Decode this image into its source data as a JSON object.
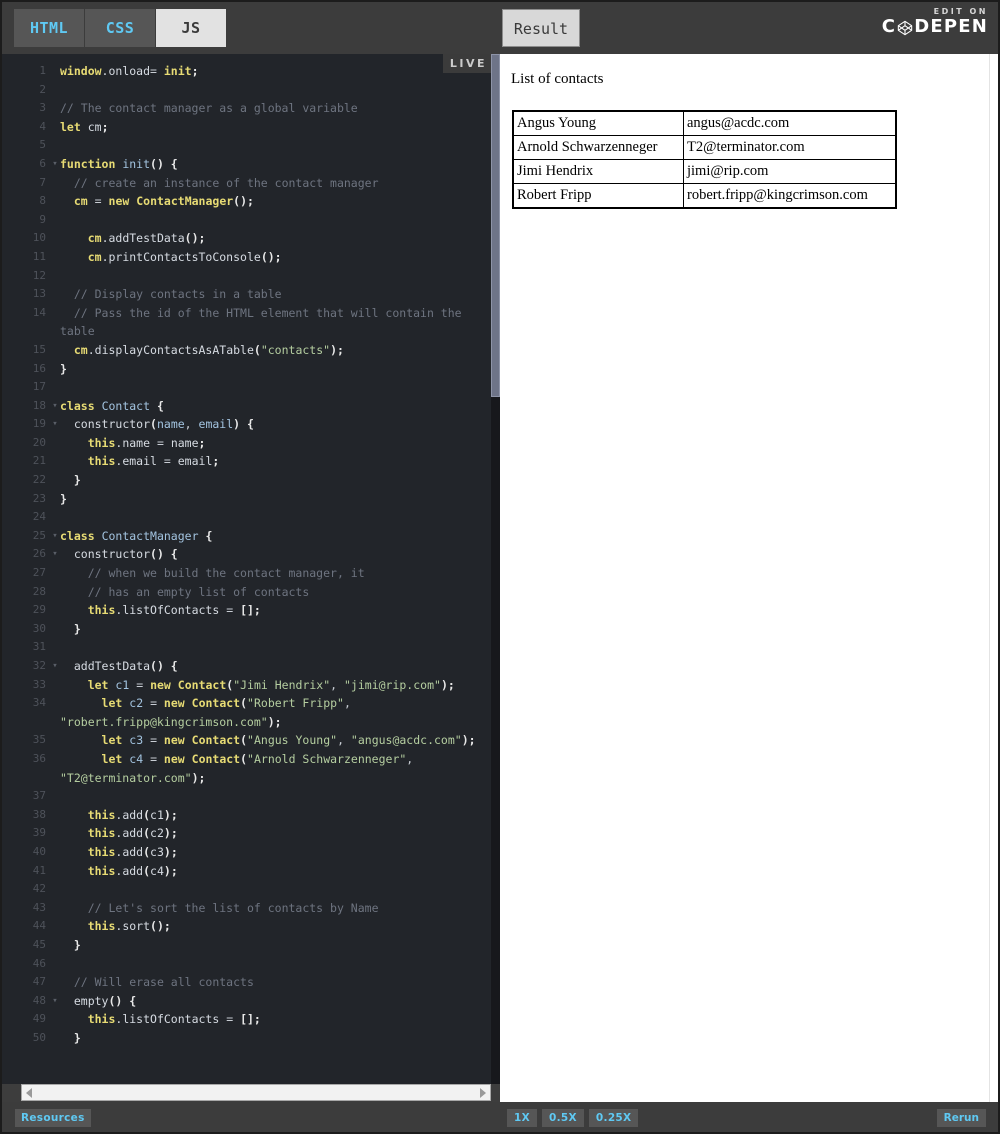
{
  "header": {
    "tabs": [
      {
        "label": "HTML",
        "active": false
      },
      {
        "label": "CSS",
        "active": false
      },
      {
        "label": "JS",
        "active": true
      }
    ],
    "result_tab_label": "Result",
    "brand_top": "EDIT ON",
    "brand_name_left": "C",
    "brand_name_right": "DEPEN",
    "live_badge": "LIVE"
  },
  "editor": {
    "language": "JS",
    "lines": [
      {
        "num": "1",
        "fold": "",
        "html": "<span class=\"kw\">window</span><span class=\"prop\">.onload</span><span class=\"plain\">= </span><span class=\"kw\">init</span><span class=\"pun\">;</span>"
      },
      {
        "num": "2",
        "fold": "",
        "html": ""
      },
      {
        "num": "3",
        "fold": "",
        "html": "<span class=\"cmt\">// The contact manager as a global variable</span>"
      },
      {
        "num": "4",
        "fold": "",
        "html": "<span class=\"kw\">let</span> <span class=\"prop\">cm</span><span class=\"pun\">;</span>"
      },
      {
        "num": "5",
        "fold": "",
        "html": ""
      },
      {
        "num": "6",
        "fold": "▾",
        "html": "<span class=\"kw\">function</span> <span class=\"fn\">init</span><span class=\"pun\">() {</span>"
      },
      {
        "num": "7",
        "fold": "",
        "html": "  <span class=\"cmt\">// create an instance of the contact manager</span>"
      },
      {
        "num": "8",
        "fold": "",
        "html": "  <span class=\"kw\">cm</span> <span class=\"plain\">= </span><span class=\"kw\">new</span> <span class=\"kw\">ContactManager</span><span class=\"pun\">();</span>"
      },
      {
        "num": "9",
        "fold": "",
        "html": ""
      },
      {
        "num": "10",
        "fold": "",
        "html": "    <span class=\"kw\">cm</span><span class=\"prop\">.addTestData</span><span class=\"pun\">();</span>"
      },
      {
        "num": "11",
        "fold": "",
        "html": "    <span class=\"kw\">cm</span><span class=\"prop\">.printContactsToConsole</span><span class=\"pun\">();</span>"
      },
      {
        "num": "12",
        "fold": "",
        "html": ""
      },
      {
        "num": "13",
        "fold": "",
        "html": "  <span class=\"cmt\">// Display contacts in a table</span>"
      },
      {
        "num": "14",
        "fold": "",
        "html": "  <span class=\"cmt\">// Pass the id of the HTML element that will contain the table</span>"
      },
      {
        "num": "15",
        "fold": "",
        "html": "  <span class=\"kw\">cm</span><span class=\"prop\">.displayContactsAsATable</span><span class=\"pun\">(</span><span class=\"str\">\"contacts\"</span><span class=\"pun\">);</span>"
      },
      {
        "num": "16",
        "fold": "",
        "html": "<span class=\"pun\">}</span>"
      },
      {
        "num": "17",
        "fold": "",
        "html": ""
      },
      {
        "num": "18",
        "fold": "▾",
        "html": "<span class=\"kw\">class</span> <span class=\"cls\">Contact</span> <span class=\"pun\">{</span>"
      },
      {
        "num": "19",
        "fold": "▾",
        "html": "  <span class=\"prop\">constructor</span><span class=\"pun\">(</span><span class=\"var\">name</span><span class=\"plain\">, </span><span class=\"var\">email</span><span class=\"pun\">) {</span>"
      },
      {
        "num": "20",
        "fold": "",
        "html": "    <span class=\"kw\">this</span><span class=\"prop\">.name</span> <span class=\"plain\">= </span><span class=\"prop\">name</span><span class=\"pun\">;</span>"
      },
      {
        "num": "21",
        "fold": "",
        "html": "    <span class=\"kw\">this</span><span class=\"prop\">.email</span> <span class=\"plain\">= </span><span class=\"prop\">email</span><span class=\"pun\">;</span>"
      },
      {
        "num": "22",
        "fold": "",
        "html": "  <span class=\"pun\">}</span>"
      },
      {
        "num": "23",
        "fold": "",
        "html": "<span class=\"pun\">}</span>"
      },
      {
        "num": "24",
        "fold": "",
        "html": ""
      },
      {
        "num": "25",
        "fold": "▾",
        "html": "<span class=\"kw\">class</span> <span class=\"cls\">ContactManager</span> <span class=\"pun\">{</span>"
      },
      {
        "num": "26",
        "fold": "▾",
        "html": "  <span class=\"prop\">constructor</span><span class=\"pun\">() {</span>"
      },
      {
        "num": "27",
        "fold": "",
        "html": "    <span class=\"cmt\">// when we build the contact manager, it</span>"
      },
      {
        "num": "28",
        "fold": "",
        "html": "    <span class=\"cmt\">// has an empty list of contacts</span>"
      },
      {
        "num": "29",
        "fold": "",
        "html": "    <span class=\"kw\">this</span><span class=\"prop\">.listOfContacts</span> <span class=\"plain\">= </span><span class=\"pun\">[];</span>"
      },
      {
        "num": "30",
        "fold": "",
        "html": "  <span class=\"pun\">}</span>"
      },
      {
        "num": "31",
        "fold": "",
        "html": ""
      },
      {
        "num": "32",
        "fold": "▾",
        "html": "  <span class=\"prop\">addTestData</span><span class=\"pun\">() {</span>"
      },
      {
        "num": "33",
        "fold": "",
        "html": "    <span class=\"kw\">let</span> <span class=\"var\">c1</span> <span class=\"plain\">= </span><span class=\"kw\">new</span> <span class=\"kw\">Contact</span><span class=\"pun\">(</span><span class=\"str\">\"Jimi Hendrix\"</span><span class=\"plain\">, </span><span class=\"str\">\"jimi@rip.com\"</span><span class=\"pun\">);</span>"
      },
      {
        "num": "34",
        "fold": "",
        "html": "      <span class=\"kw\">let</span> <span class=\"var\">c2</span> <span class=\"plain\">= </span><span class=\"kw\">new</span> <span class=\"kw\">Contact</span><span class=\"pun\">(</span><span class=\"str\">\"Robert Fripp\"</span><span class=\"plain\">, </span><span class=\"str\">\"robert.fripp@kingcrimson.com\"</span><span class=\"pun\">);</span>"
      },
      {
        "num": "35",
        "fold": "",
        "html": "      <span class=\"kw\">let</span> <span class=\"var\">c3</span> <span class=\"plain\">= </span><span class=\"kw\">new</span> <span class=\"kw\">Contact</span><span class=\"pun\">(</span><span class=\"str\">\"Angus Young\"</span><span class=\"plain\">, </span><span class=\"str\">\"angus@acdc.com\"</span><span class=\"pun\">);</span>"
      },
      {
        "num": "36",
        "fold": "",
        "html": "      <span class=\"kw\">let</span> <span class=\"var\">c4</span> <span class=\"plain\">= </span><span class=\"kw\">new</span> <span class=\"kw\">Contact</span><span class=\"pun\">(</span><span class=\"str\">\"Arnold Schwarzenneger\"</span><span class=\"plain\">, </span><span class=\"str\">\"T2@terminator.com\"</span><span class=\"pun\">);</span>"
      },
      {
        "num": "37",
        "fold": "",
        "html": ""
      },
      {
        "num": "38",
        "fold": "",
        "html": "    <span class=\"kw\">this</span><span class=\"prop\">.add</span><span class=\"pun\">(</span><span class=\"prop\">c1</span><span class=\"pun\">);</span>"
      },
      {
        "num": "39",
        "fold": "",
        "html": "    <span class=\"kw\">this</span><span class=\"prop\">.add</span><span class=\"pun\">(</span><span class=\"prop\">c2</span><span class=\"pun\">);</span>"
      },
      {
        "num": "40",
        "fold": "",
        "html": "    <span class=\"kw\">this</span><span class=\"prop\">.add</span><span class=\"pun\">(</span><span class=\"prop\">c3</span><span class=\"pun\">);</span>"
      },
      {
        "num": "41",
        "fold": "",
        "html": "    <span class=\"kw\">this</span><span class=\"prop\">.add</span><span class=\"pun\">(</span><span class=\"prop\">c4</span><span class=\"pun\">);</span>"
      },
      {
        "num": "42",
        "fold": "",
        "html": ""
      },
      {
        "num": "43",
        "fold": "",
        "html": "    <span class=\"cmt\">// Let's sort the list of contacts by Name</span>"
      },
      {
        "num": "44",
        "fold": "",
        "html": "    <span class=\"kw\">this</span><span class=\"prop\">.sort</span><span class=\"pun\">();</span>"
      },
      {
        "num": "45",
        "fold": "",
        "html": "  <span class=\"pun\">}</span>"
      },
      {
        "num": "46",
        "fold": "",
        "html": ""
      },
      {
        "num": "47",
        "fold": "",
        "html": "  <span class=\"cmt\">// Will erase all contacts</span>"
      },
      {
        "num": "48",
        "fold": "▾",
        "html": "  <span class=\"prop\">empty</span><span class=\"pun\">() {</span>"
      },
      {
        "num": "49",
        "fold": "",
        "html": "    <span class=\"kw\">this</span><span class=\"prop\">.listOfContacts</span> <span class=\"plain\">= </span><span class=\"pun\">[];</span>"
      },
      {
        "num": "50",
        "fold": "",
        "html": "  <span class=\"pun\">}</span>"
      }
    ]
  },
  "result": {
    "heading": "List of contacts",
    "table": {
      "rows": [
        {
          "name": "Angus Young",
          "email": "angus@acdc.com"
        },
        {
          "name": "Arnold Schwarzenneger",
          "email": "T2@terminator.com"
        },
        {
          "name": "Jimi Hendrix",
          "email": "jimi@rip.com"
        },
        {
          "name": "Robert Fripp",
          "email": "robert.fripp@kingcrimson.com"
        }
      ]
    }
  },
  "footer": {
    "resources_label": "Resources",
    "zoom_levels": [
      "1X",
      "0.5X",
      "0.25X"
    ],
    "rerun_label": "Rerun"
  }
}
